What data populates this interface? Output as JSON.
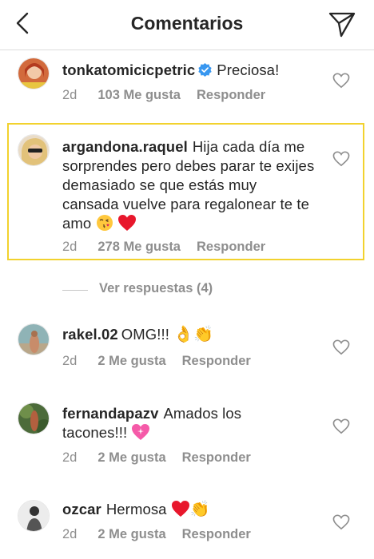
{
  "header": {
    "title": "Comentarios",
    "back_icon": "chevron-left-icon",
    "send_icon": "paper-plane-icon"
  },
  "comments": [
    {
      "username": "tonkatomicicpetric",
      "verified": true,
      "text": "Preciosa!",
      "time": "2d",
      "likes": "103 Me gusta",
      "reply": "Responder"
    },
    {
      "username": "argandona.raquel",
      "verified": false,
      "text": "Hija cada día me sorprendes pero debes parar te exijes demasiado se que estás muy cansada vuelve para regalonear te te amo",
      "emojis": [
        "kiss-face",
        "red-heart"
      ],
      "time": "2d",
      "likes": "278 Me gusta",
      "reply": "Responder",
      "highlighted": true
    },
    {
      "username": "rakel.02",
      "verified": false,
      "text": "OMG!!!",
      "emojis": [
        "ok-hand",
        "clapping-hands"
      ],
      "time": "2d",
      "likes": "2 Me gusta",
      "reply": "Responder"
    },
    {
      "username": "fernandapazv",
      "verified": false,
      "text": "Amados los tacones!!!",
      "emojis": [
        "sparkling-heart"
      ],
      "time": "2d",
      "likes": "2 Me gusta",
      "reply": "Responder"
    },
    {
      "username": "ozcar",
      "verified": false,
      "text": "Hermosa",
      "emojis": [
        "red-heart",
        "clapping-hands"
      ],
      "time": "2d",
      "likes": "2 Me gusta",
      "reply": "Responder"
    }
  ],
  "view_replies": "Ver respuestas (4)",
  "colors": {
    "text": "#262626",
    "muted": "#8e8e8e",
    "verified": "#3897f0",
    "highlight_border": "#f2d22e",
    "divider": "#dbdbdb"
  }
}
